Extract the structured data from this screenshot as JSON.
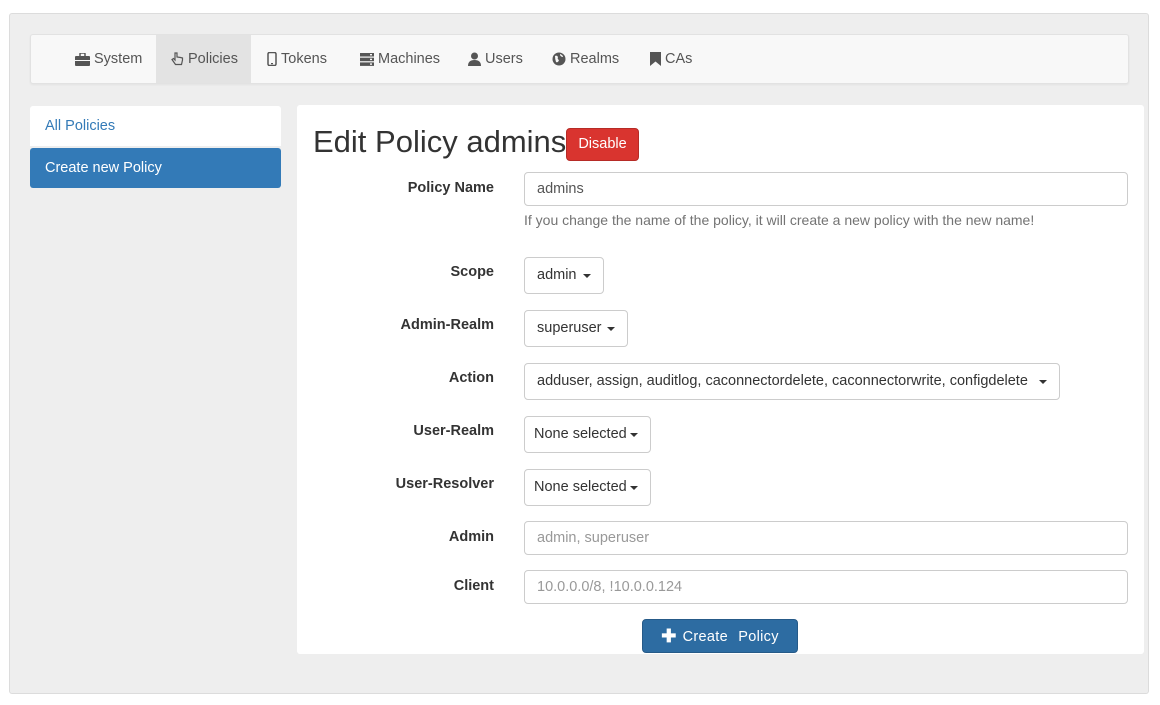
{
  "nav": {
    "items": [
      {
        "label": "System",
        "icon": "briefcase-icon"
      },
      {
        "label": "Policies",
        "icon": "hand-pointer-icon",
        "active": true
      },
      {
        "label": "Tokens",
        "icon": "phone-icon"
      },
      {
        "label": "Machines",
        "icon": "server-icon"
      },
      {
        "label": "Users",
        "icon": "user-icon"
      },
      {
        "label": "Realms",
        "icon": "globe-icon"
      },
      {
        "label": "CAs",
        "icon": "bookmark-icon"
      }
    ]
  },
  "sidebar": {
    "items": [
      {
        "label": "All Policies"
      },
      {
        "label": "Create new Policy",
        "active": true
      }
    ]
  },
  "main": {
    "title": "Edit Policy admins",
    "disable_label": "Disable",
    "fields": {
      "policy_name": {
        "label": "Policy Name",
        "value": "admins",
        "help": "If you change the name of the policy, it will create a new policy with the new name!"
      },
      "scope": {
        "label": "Scope",
        "value": "admin"
      },
      "admin_realm": {
        "label": "Admin-Realm",
        "value": "superuser"
      },
      "action": {
        "label": "Action",
        "value": "adduser,  assign,  auditlog,  caconnectordelete,  caconnectorwrite,  configdelete"
      },
      "user_realm": {
        "label": "User-Realm",
        "value": "None selected"
      },
      "user_resolver": {
        "label": "User-Resolver",
        "value": "None selected"
      },
      "admin": {
        "label": "Admin",
        "placeholder": "admin, superuser"
      },
      "client": {
        "label": "Client",
        "placeholder": "10.0.0.0/8, !10.0.0.124"
      }
    },
    "create_label": "Create Policy"
  },
  "colors": {
    "primary": "#337ab7",
    "danger": "#d9342f",
    "create_button": "#2d6ca2"
  }
}
